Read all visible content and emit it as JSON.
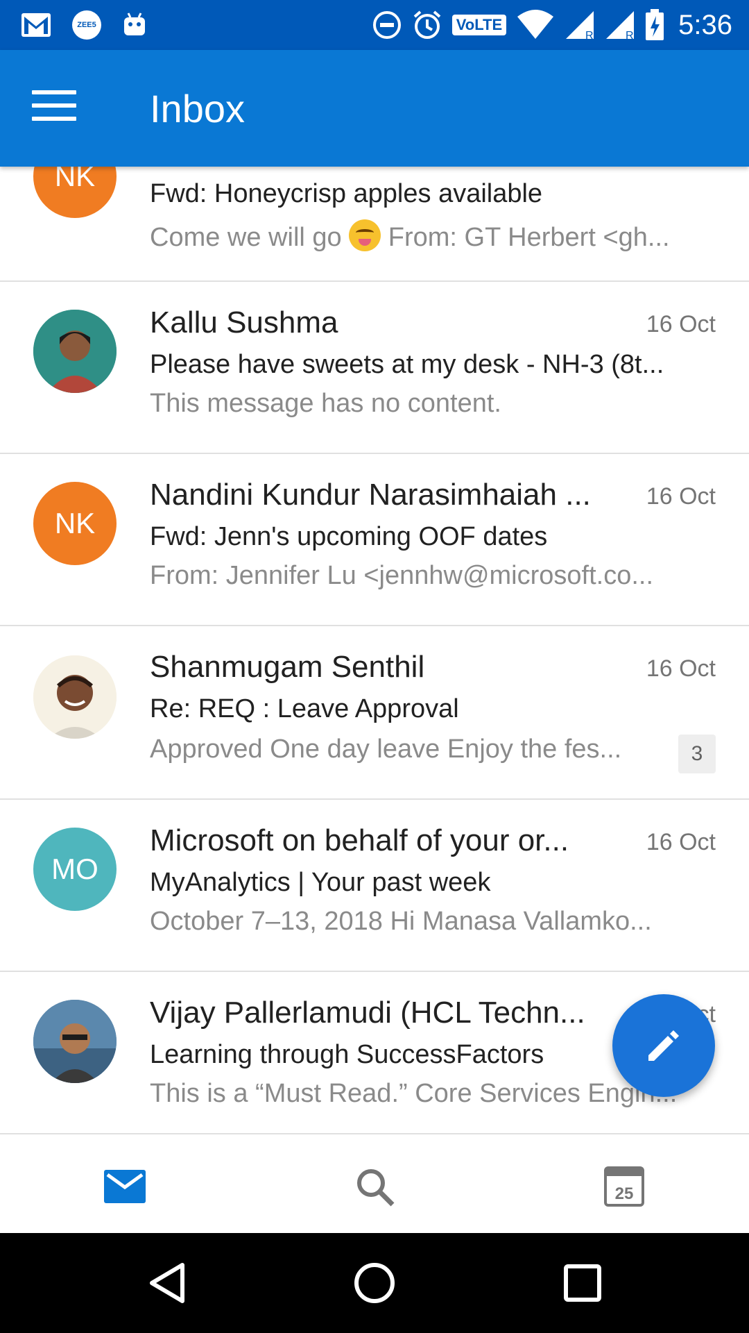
{
  "status_bar": {
    "time": "5:36",
    "volte_label": "VoLTE",
    "zee5_label": "ZEE5"
  },
  "app_bar": {
    "title": "Inbox"
  },
  "messages": [
    {
      "initials": "NK",
      "avatar_color": "#f07c22",
      "subject": "Fwd: Honeycrisp apples available",
      "preview_before": "Come we will go ",
      "preview_after": " From: GT Herbert <gh..."
    },
    {
      "sender": "Kallu Sushma",
      "date": "16 Oct",
      "subject": "Please have sweets at my desk - NH-3 (8t...",
      "preview": "This message has no content."
    },
    {
      "initials": "NK",
      "avatar_color": "#f07c22",
      "sender": "Nandini Kundur Narasimhaiah ...",
      "date": "16 Oct",
      "subject": "Fwd: Jenn's upcoming OOF dates",
      "preview": "From: Jennifer Lu <jennhw@microsoft.co..."
    },
    {
      "sender": "Shanmugam Senthil",
      "date": "16 Oct",
      "subject": "Re: REQ : Leave Approval",
      "preview": "Approved One day leave Enjoy the fes...",
      "count": "3"
    },
    {
      "initials": "MO",
      "avatar_color": "#4fb6bd",
      "sender": "Microsoft on behalf of your or...",
      "date": "16 Oct",
      "subject": "MyAnalytics | Your past week",
      "preview": "October 7–13, 2018 Hi Manasa Vallamko..."
    },
    {
      "sender": "Vijay Pallerlamudi (HCL Techn...",
      "date": "16 Oct",
      "subject": "Learning through SuccessFactors",
      "preview": "This is a “Must Read.” Core Services Engin..."
    }
  ],
  "bottom_nav": {
    "calendar_day": "25",
    "active": "mail"
  },
  "colors": {
    "status_bar": "#0059b8",
    "app_bar": "#0a78d4",
    "accent": "#1a73d8",
    "orange_avatar": "#f07c22",
    "teal_avatar": "#4fb6bd"
  }
}
